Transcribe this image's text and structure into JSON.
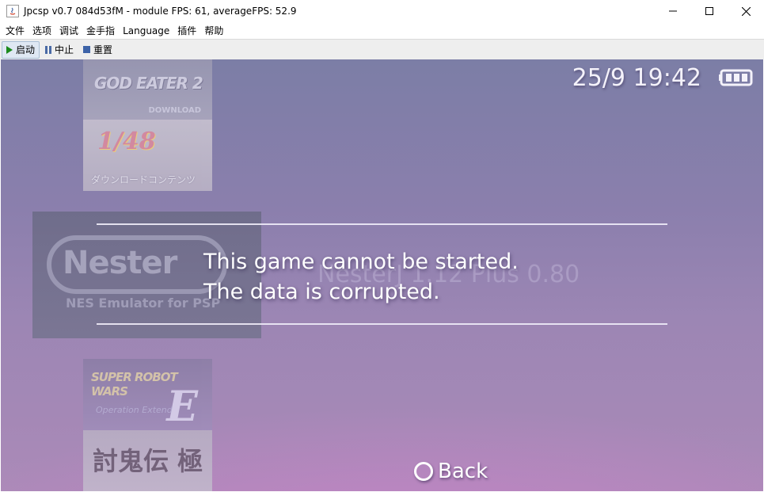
{
  "window": {
    "title": "Jpcsp v0.7 084d53fM - module FPS: 61, averageFPS: 52.9",
    "app_icon": "java-icon",
    "controls": [
      "minimize-icon",
      "maximize-icon",
      "close-icon"
    ]
  },
  "menubar": {
    "items": [
      "文件",
      "选项",
      "调试",
      "金手指",
      "Language",
      "插件",
      "帮助"
    ]
  },
  "toolbar": {
    "run_label": "启动",
    "pause_label": "中止",
    "reset_label": "重置"
  },
  "psp": {
    "datetime": "25/9 19:42",
    "battery_icon": "battery-full-icon",
    "games": {
      "godeater_title": "GOD EATER 2",
      "godeater_sub": "DOWNLOAD",
      "tile148_title": "1/48",
      "tile148_sub": "ダウンロードコンテンツ",
      "nester_logo": "Nester",
      "nester_sub": "NES Emulator for PSP",
      "nester_ghost_title": "NesterJ 1.12 Plus 0.80",
      "srw_title": "SUPER ROBOT WARS",
      "srw_letter": "E",
      "srw_sub": "Operation Extend",
      "oni_title": "討鬼伝 極"
    },
    "dialog": {
      "line1": "This game cannot be started.",
      "line2": "The data is corrupted."
    },
    "back_label": "Back",
    "back_icon": "circle-button-icon"
  }
}
